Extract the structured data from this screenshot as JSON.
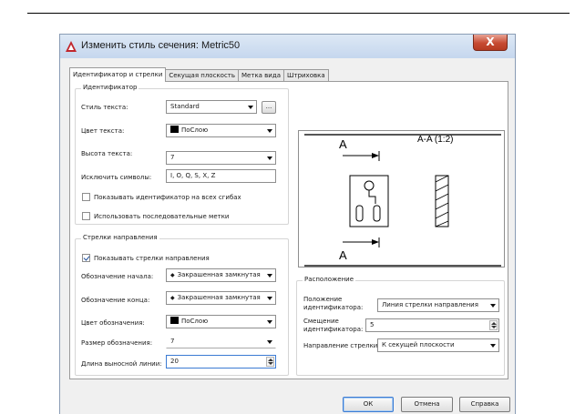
{
  "window": {
    "title": "Изменить стиль сечения: Metric50",
    "close_glyph": "X"
  },
  "tabs": [
    {
      "label": "Идентификатор и стрелки",
      "active": true
    },
    {
      "label": "Секущая плоскость",
      "active": false
    },
    {
      "label": "Метка вида",
      "active": false
    },
    {
      "label": "Штриховка",
      "active": false
    }
  ],
  "identifier": {
    "group_title": "Идентификатор",
    "text_style_label": "Стиль текста:",
    "text_style_value": "Standard",
    "browse_label": "...",
    "text_color_label": "Цвет текста:",
    "text_color_value": "ПоСлою",
    "text_height_label": "Высота текста:",
    "text_height_value": "7",
    "exclude_label": "Исключить символы:",
    "exclude_value": "I, O, Q, S, X, Z",
    "show_all_bends_label": "Показывать идентификатор на всех сгибах",
    "show_all_bends_checked": false,
    "consecutive_label": "Использовать последовательные метки",
    "consecutive_checked": false
  },
  "arrows": {
    "group_title": "Стрелки направления",
    "show_arrows_label": "Показывать стрелки направления",
    "show_arrows_checked": true,
    "start_label": "Обозначение начала:",
    "start_value": "Закрашенная замкнутая",
    "end_label": "Обозначение конца:",
    "end_value": "Закрашенная замкнутая",
    "color_label": "Цвет обозначения:",
    "color_value": "ПоСлою",
    "size_label": "Размер обозначения:",
    "size_value": "7",
    "ext_label": "Длина выносной линии:",
    "ext_value": "20"
  },
  "preview": {
    "label_a_top": "A",
    "label_a_bottom": "A",
    "view_label": "A-A (1:2)"
  },
  "placement": {
    "group_title": "Расположение",
    "position_label": "Положение идентификатора:",
    "position_value": "Линия стрелки направления",
    "offset_label": "Смещение идентификатора:",
    "offset_value": "5",
    "direction_label": "Направление стрелки:",
    "direction_value": "К секущей плоскости"
  },
  "buttons": {
    "ok": "ОК",
    "cancel": "Отмена",
    "help": "Справка"
  },
  "colors": {
    "accent": "#3b7bd3",
    "swatch": "#000000"
  }
}
